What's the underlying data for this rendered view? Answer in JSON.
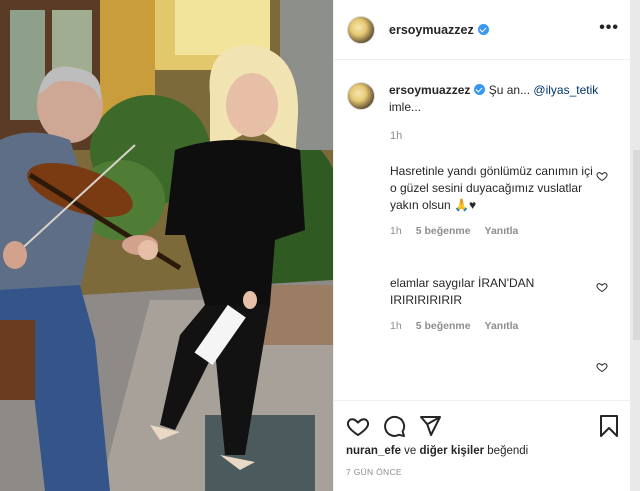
{
  "post": {
    "username": "ersoymuazzez",
    "more_label": "•••"
  },
  "caption": {
    "username": "ersoymuazzez",
    "text_pre": " Şu an... ",
    "mention": "@ilyas_tetik",
    "text_post": "imle...",
    "time": "1h"
  },
  "comments": [
    {
      "text": "Hasretinle yandı gönlümüz canımın içi o güzel sesini duyacağımız vuslatlar yakın olsun 🙏♥",
      "time": "1h",
      "likes": "5 beğenme",
      "reply": "Yanıtla"
    },
    {
      "text": "elamlar saygılar İRAN'DAN IRIRIRIRIRIR",
      "time": "1h",
      "likes": "5 beğenme",
      "reply": "Yanıtla"
    }
  ],
  "actions": {
    "like_icon": "heart-icon",
    "comment_icon": "comment-icon",
    "share_icon": "share-icon",
    "save_icon": "bookmark-icon"
  },
  "likes": {
    "user": "nuran_efe",
    "connector": " ve ",
    "others": "diğer kişiler",
    "suffix": " beğendi"
  },
  "date": "7 GÜN ÖNCE"
}
